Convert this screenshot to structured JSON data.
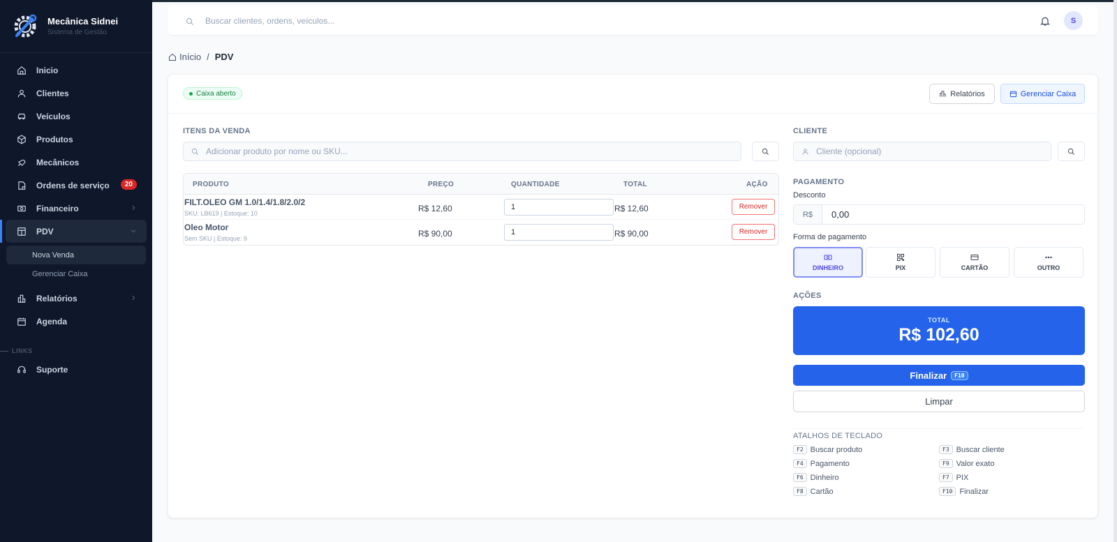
{
  "brand": {
    "name": "Mecânica Sidnei",
    "subtitle": "Sistema de Gestão"
  },
  "sidebar": {
    "items": [
      {
        "label": "Inicio",
        "icon": "home-icon"
      },
      {
        "label": "Clientes",
        "icon": "user-icon"
      },
      {
        "label": "Veículos",
        "icon": "car-icon"
      },
      {
        "label": "Produtos",
        "icon": "box-icon"
      },
      {
        "label": "Mecânicos",
        "icon": "wrench-icon"
      },
      {
        "label": "Ordens de serviço",
        "icon": "document-icon",
        "badge": "20"
      },
      {
        "label": "Financeiro",
        "icon": "money-icon"
      },
      {
        "label": "PDV",
        "icon": "store-icon"
      }
    ],
    "pdv_sub": [
      {
        "label": "Nova Venda"
      },
      {
        "label": "Gerenciar Caixa"
      }
    ],
    "items_after": [
      {
        "label": "Relatórios",
        "icon": "chart-icon"
      },
      {
        "label": "Agenda",
        "icon": "calendar-icon"
      }
    ],
    "links_section": "LINKS",
    "links": [
      {
        "label": "Suporte",
        "icon": "headset-icon"
      }
    ]
  },
  "topbar": {
    "search_placeholder": "Buscar clientes, ordens, veículos...",
    "avatar_initial": "S"
  },
  "breadcrumb": {
    "home": "Início",
    "separator": "/",
    "current": "PDV"
  },
  "header": {
    "status": "Caixa aberto",
    "btn_reports": "Relatórios",
    "btn_manage": "Gerenciar Caixa"
  },
  "items_section": {
    "title": "ITENS DA VENDA",
    "search_placeholder": "Adicionar produto por nome ou SKU...",
    "columns": {
      "product": "PRODUTO",
      "price": "PREÇO",
      "qty": "QUANTIDADE",
      "total": "TOTAL",
      "action": "AÇÃO"
    },
    "rows": [
      {
        "name": "FILT.OLEO GM 1.0/1.4/1.8/2.0/2",
        "meta": "SKU: LB619 | Estoque: 10",
        "price": "R$ 12,60",
        "qty": "1",
        "total": "R$ 12,60",
        "action": "Remover"
      },
      {
        "name": "Oleo Motor",
        "meta": "Sem SKU | Estoque: 9",
        "price": "R$ 90,00",
        "qty": "1",
        "total": "R$ 90,00",
        "action": "Remover"
      }
    ]
  },
  "client_section": {
    "title": "CLIENTE",
    "placeholder": "Cliente (opcional)"
  },
  "payment_section": {
    "title": "PAGAMENTO",
    "discount_label": "Desconto",
    "currency": "R$",
    "discount_value": "0,00",
    "method_label": "Forma de pagamento",
    "methods": [
      {
        "label": "DINHEIRO",
        "icon": "cash-icon",
        "selected": true
      },
      {
        "label": "PIX",
        "icon": "qr-icon"
      },
      {
        "label": "CARTÃO",
        "icon": "card-icon"
      },
      {
        "label": "OUTRO",
        "icon": "more-icon"
      }
    ]
  },
  "actions_section": {
    "title": "AÇÕES",
    "total_label": "TOTAL",
    "total_value": "R$ 102,60",
    "finalize": "Finalizar",
    "finalize_key": "F10",
    "clear": "Limpar"
  },
  "shortcuts": {
    "title": "ATALHOS DE TECLADO",
    "items": [
      {
        "key": "F2",
        "label": "Buscar produto"
      },
      {
        "key": "F3",
        "label": "Buscar cliente"
      },
      {
        "key": "F4",
        "label": "Pagamento"
      },
      {
        "key": "F9",
        "label": "Valor exato"
      },
      {
        "key": "F6",
        "label": "Dinheiro"
      },
      {
        "key": "F7",
        "label": "PIX"
      },
      {
        "key": "F8",
        "label": "Cartão"
      },
      {
        "key": "F10",
        "label": "Finalizar"
      }
    ]
  },
  "colors": {
    "accent": "#2563eb",
    "sidebar_bg": "#0f172a",
    "danger": "#dc2626",
    "success": "#16a34a"
  }
}
